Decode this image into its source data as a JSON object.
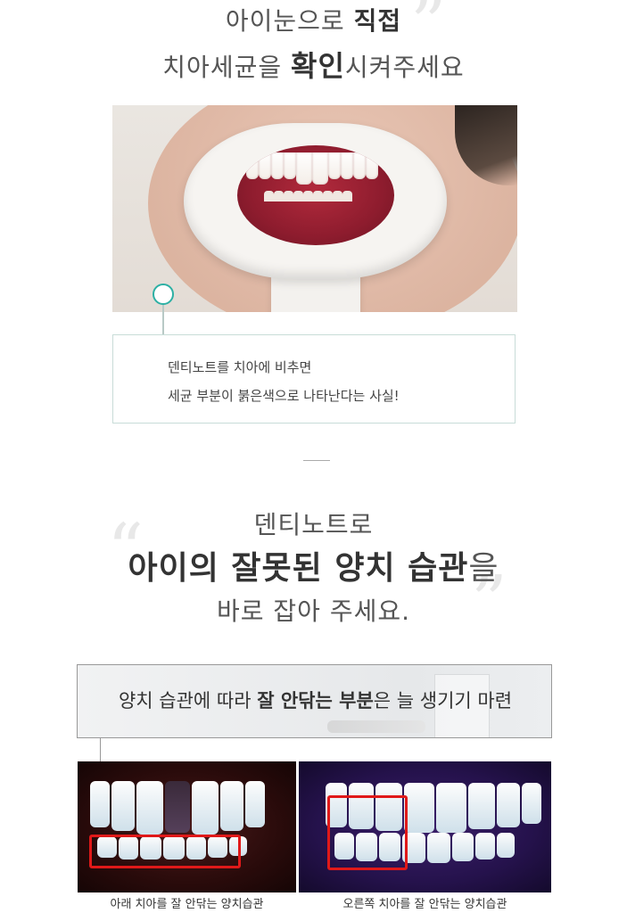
{
  "section1": {
    "title_line1_pre": "아이눈으로 ",
    "title_line1_bold": "직접",
    "title_line2_pre": "치아세균을 ",
    "title_line2_bold": "확인",
    "title_line2_post": "시켜주세요",
    "desc_line1": "덴티노트를 치아에 비추면",
    "desc_line2": "세균 부분이 붉은색으로 나타난다는 사실!"
  },
  "section2": {
    "line1": "덴티노트로",
    "line2_bold": "아이의 잘못된 양치 습관",
    "line2_post": "을",
    "line3": "바로 잡아 주세요.",
    "banner_pre": "양치 습관에 따라 ",
    "banner_bold1": "잘 안닦는 부분",
    "banner_mid": "은 늘 생기기 마련",
    "caption_left": "아래 치아를 잘 안닦는 양치습관",
    "caption_right": "오른쪽 치아를 잘 안닦는 양치습관"
  },
  "colors": {
    "accent": "#2db0a4",
    "highlight_box": "#e01919"
  }
}
